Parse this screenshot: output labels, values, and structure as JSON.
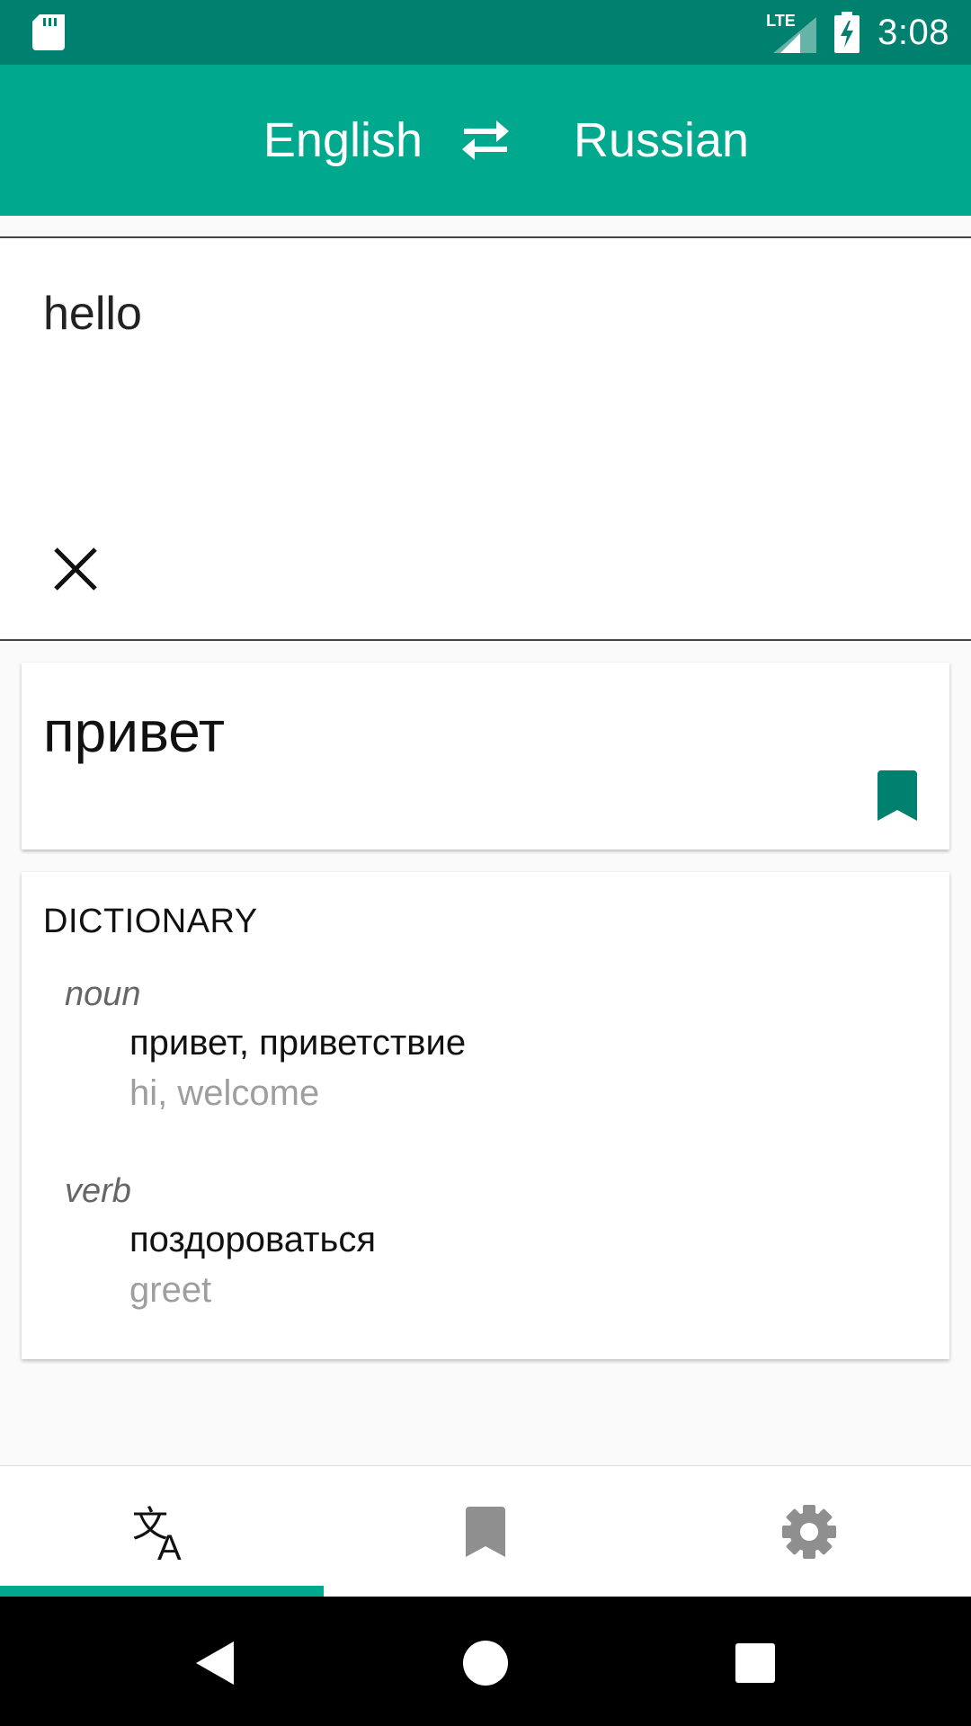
{
  "status_bar": {
    "time": "3:08",
    "network": "LTE",
    "icons": [
      "sd-card-icon",
      "signal-icon",
      "battery-charging-icon"
    ]
  },
  "header": {
    "source_language": "English",
    "target_language": "Russian",
    "swap_icon": "swap-icon",
    "background": "#00a88e"
  },
  "input": {
    "text": "hello",
    "clear_icon": "close-icon"
  },
  "translation": {
    "text": "привет",
    "bookmark_icon": "bookmark-icon",
    "bookmark_color": "#00806f"
  },
  "dictionary": {
    "title": "DICTIONARY",
    "entries": [
      {
        "part_of_speech": "noun",
        "translations": "привет, приветствие",
        "back_translations": "hi, welcome"
      },
      {
        "part_of_speech": "verb",
        "translations": "поздороваться",
        "back_translations": "greet"
      }
    ]
  },
  "bottom_nav": {
    "tabs": [
      {
        "icon": "translate-icon",
        "active": true
      },
      {
        "icon": "bookmarks-icon",
        "active": false
      },
      {
        "icon": "settings-icon",
        "active": false
      }
    ],
    "accent": "#00a88e"
  },
  "system_nav": {
    "buttons": [
      "back-icon",
      "home-icon",
      "recents-icon"
    ]
  }
}
